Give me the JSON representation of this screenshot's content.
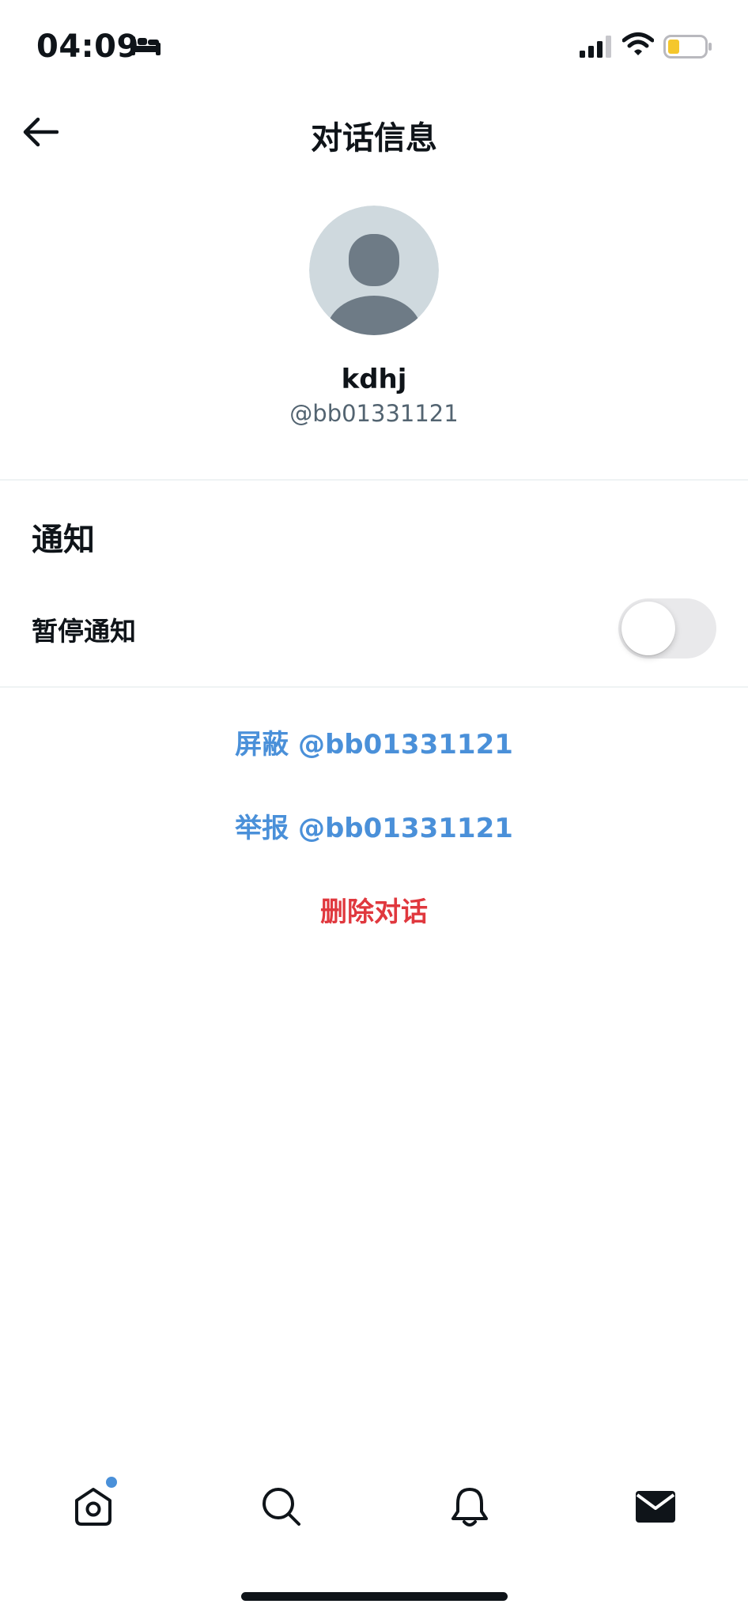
{
  "status_bar": {
    "time": "04:09",
    "icons": [
      "sleep-mode-icon",
      "cellular-signal-icon",
      "wifi-icon",
      "battery-low-icon"
    ]
  },
  "header": {
    "back_icon": "arrow-left-icon",
    "title": "对话信息"
  },
  "profile": {
    "avatar_icon": "default-avatar-icon",
    "display_name": "kdhj",
    "handle": "@bb01331121"
  },
  "notifications": {
    "heading": "通知",
    "pause_label": "暂停通知",
    "pause_enabled": false
  },
  "actions": {
    "block_label": "屏蔽 @bb01331121",
    "report_label": "举报 @bb01331121",
    "delete_label": "删除对话"
  },
  "tab_bar": {
    "tabs": [
      {
        "icon": "home-icon",
        "has_badge": true
      },
      {
        "icon": "search-icon",
        "has_badge": false
      },
      {
        "icon": "bell-icon",
        "has_badge": false
      },
      {
        "icon": "mail-icon",
        "active": true
      }
    ]
  },
  "colors": {
    "link_blue": "#4a90d9",
    "destructive_red": "#e0383e",
    "secondary_text": "#536471",
    "battery_level": "#f5c72c"
  }
}
